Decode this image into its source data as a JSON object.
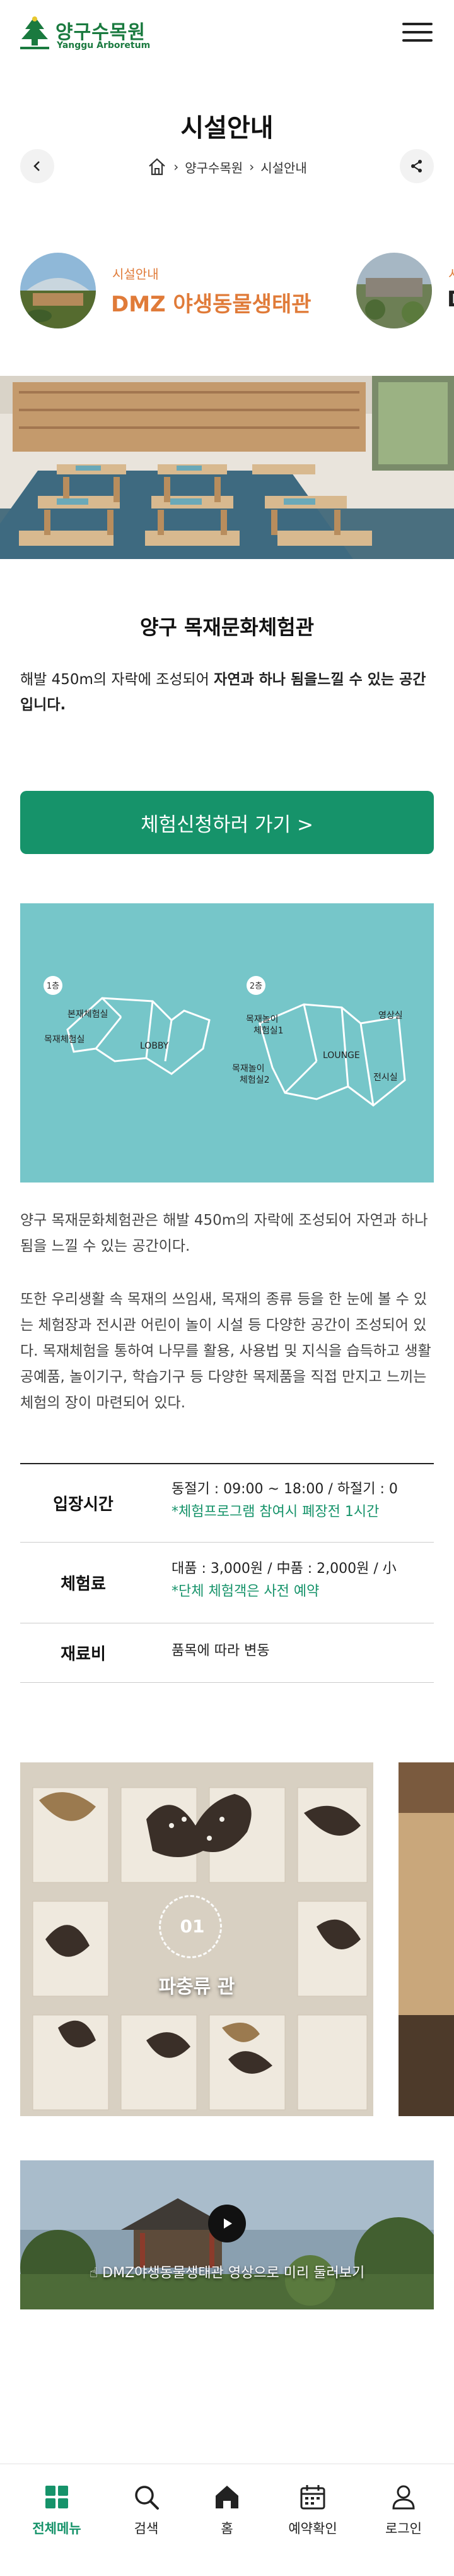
{
  "header": {
    "logo_ko": "양구수목원",
    "logo_en": "Yanggu Arboretum",
    "menu_icon": "hamburger-icon"
  },
  "page": {
    "title": "시설안내",
    "breadcrumb": [
      "양구수목원",
      "시설안내"
    ]
  },
  "facility_carousel": [
    {
      "category": "시설안내",
      "name": "DMZ 야생동물생태관"
    },
    {
      "category": "시",
      "name": "D"
    }
  ],
  "section": {
    "title": "양구 목재문화체험관",
    "intro_prefix": "해발 450m의 자락에 조성되어 ",
    "intro_bold": "자연과 하나 됨을느낄 수 있는 공간입니다.",
    "apply_button": "체험신청하러 가기 >"
  },
  "floor_map": {
    "floor1": {
      "label": "1층",
      "rooms": [
        "본재체험실",
        "목재체험실",
        "LOBBY"
      ]
    },
    "floor2": {
      "label": "2층",
      "rooms": [
        "영상실",
        "목재놀이 체험실1",
        "목재놀이 체험실2",
        "LOUNGE",
        "전시실"
      ]
    }
  },
  "description": [
    "양구 목재문화체험관은 해발 450m의 자락에 조성되어 자연과 하나 됨을 느낄 수 있는 공간이다.",
    "또한 우리생활 속 목재의 쓰임새, 목재의 종류 등을 한 눈에 볼 수 있는 체험장과 전시관 어린이 놀이 시설 등 다양한 공간이 조성되어 있다. 목재체험을 통하여 나무를 활용, 사용법 및 지식을 습득하고 생활 공예품, 놀이기구, 학습기구 등 다양한 목제품을 직접 만지고 느끼는 체험의 장이 마련되어 있다."
  ],
  "info": [
    {
      "key": "입장시간",
      "lines": [
        "동절기 : 09:00 ~ 18:00 / 하절기 : 0"
      ],
      "note": "*체험프로그램 참여시 폐장전 1시간"
    },
    {
      "key": "체험료",
      "lines": [
        "대품 : 3,000원 / 中품 : 2,000원 / 小"
      ],
      "note": "*단체 체험객은 사전 예약"
    },
    {
      "key": "재료비",
      "lines": [
        "품목에 따라 변동"
      ],
      "note": ""
    }
  ],
  "gallery": [
    {
      "number": "01",
      "label": "파충류 관"
    }
  ],
  "video": {
    "caption": "DMZ야생동물생태관 영상으로 미리 둘러보기"
  },
  "bottom_nav": [
    {
      "label": "전체메뉴",
      "icon": "grid-icon",
      "active": true
    },
    {
      "label": "검색",
      "icon": "search-icon",
      "active": false
    },
    {
      "label": "홈",
      "icon": "home-icon",
      "active": false
    },
    {
      "label": "예약확인",
      "icon": "calendar-icon",
      "active": false
    },
    {
      "label": "로그인",
      "icon": "user-icon",
      "active": false
    }
  ],
  "colors": {
    "brand_green": "#16936a",
    "logo_green": "#1a7a3f",
    "accent_orange": "#e07b39",
    "map_teal": "#76c6c9"
  }
}
